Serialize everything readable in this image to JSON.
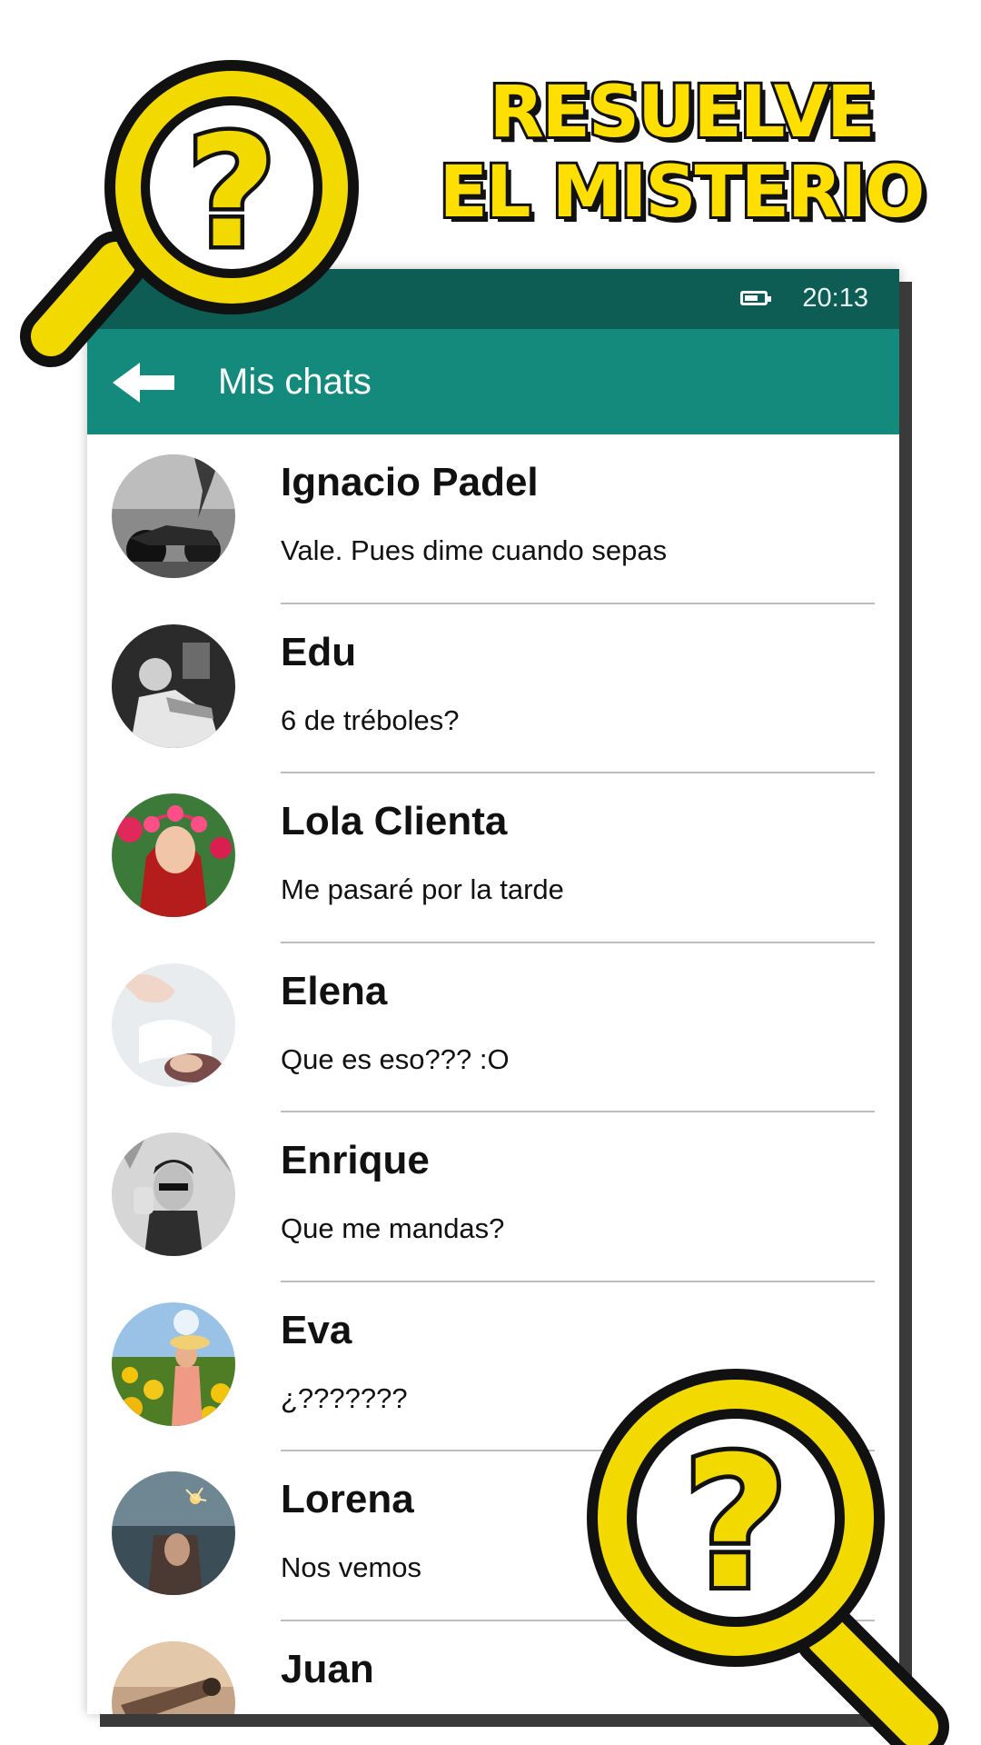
{
  "headline": {
    "line1": "RESUELVE",
    "line2": "EL MISTERIO"
  },
  "statusbar": {
    "time": "20:13",
    "battery_icon": "battery-icon"
  },
  "appbar": {
    "title": "Mis chats",
    "back_icon": "arrow-left-icon"
  },
  "chats": [
    {
      "name": "Ignacio Padel",
      "message": "Vale. Pues dime cuando sepas"
    },
    {
      "name": "Edu",
      "message": "6 de tréboles?"
    },
    {
      "name": "Lola Clienta",
      "message": "Me pasaré por la tarde"
    },
    {
      "name": "Elena",
      "message": "Que es eso??? :O"
    },
    {
      "name": "Enrique",
      "message": "Que me mandas?"
    },
    {
      "name": "Eva",
      "message": "¿???????"
    },
    {
      "name": "Lorena",
      "message": "Nos vemos"
    },
    {
      "name": "Juan",
      "message": ""
    }
  ],
  "colors": {
    "statusbar": "#0d5d54",
    "appbar": "#138a7b",
    "headline_yellow": "#ffdf00",
    "magnifier_yellow": "#f2d900"
  }
}
